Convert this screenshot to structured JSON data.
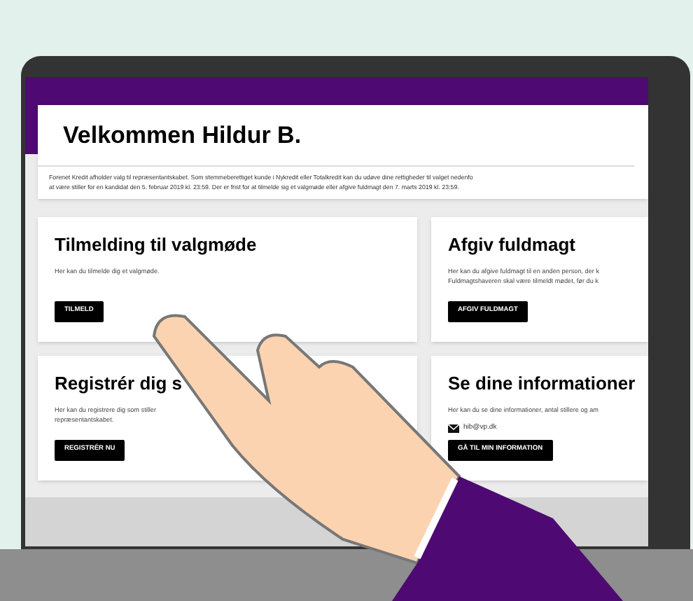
{
  "header": {
    "title": "Velkommen Hildur B.",
    "intro_lines": [
      "Forenet Kredit afholder valg til repræsentantskabet. Som stemmeberettiget kunde i Nykredit eller Totalkredit kan du udøve dine rettigheder til valget nedenfo",
      "at være stiller for en kandidat den 5. februar 2019 kl. 23:59. Der er frist for at tilmelde sig et valgmøde eller afgive fuldmagt den 7. marts 2019 kl. 23:59."
    ]
  },
  "cards": [
    {
      "title": "Tilmelding til valgmøde",
      "description_lines": [
        "Her kan du tilmelde dig et valgmøde."
      ],
      "button": "TILMELD"
    },
    {
      "title": "Afgiv fuldmagt",
      "description_lines": [
        "Her kan du afgive fuldmagt til en anden person, der k",
        "Fuldmagtshaveren skal være tilmeldt mødet, før du k"
      ],
      "button": "AFGIV FULDMAGT"
    },
    {
      "title": "Registrér dig s",
      "description_lines": [
        "Her kan du registrere dig som stiller",
        "repræsentantskabet."
      ],
      "button": "REGISTRÉR NU"
    },
    {
      "title": "Se dine informationer",
      "description_lines": [
        "Her kan du se dine informationer, antal stillere og am"
      ],
      "email": "hib@vp.dk",
      "button": "GÅ TIL MIN INFORMATION"
    }
  ]
}
